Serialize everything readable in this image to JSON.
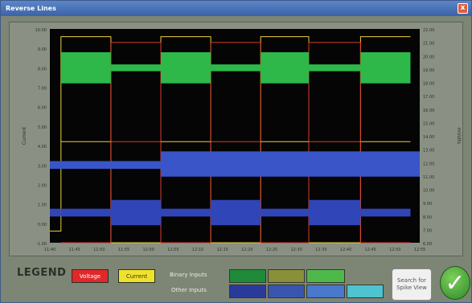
{
  "window": {
    "title": "Reverse Lines",
    "close_glyph": "x"
  },
  "chart": {
    "y_left_label": "Current",
    "y_right_label": "mVolts",
    "y_left_ticks": [
      "10.00",
      "9.00",
      "8.00",
      "7.00",
      "6.00",
      "5.00",
      "4.00",
      "3.00",
      "2.00",
      "1.00",
      "0.00",
      "-1.00"
    ],
    "y_right_ticks": [
      "22.00",
      "21.00",
      "20.00",
      "19.00",
      "18.00",
      "17.00",
      "16.00",
      "15.00",
      "14.00",
      "13.00",
      "12.00",
      "11.00",
      "10.00",
      "9.00",
      "8.00",
      "7.00",
      "6.00"
    ],
    "x_ticks": [
      "11:40",
      "11:45",
      "11:50",
      "11:55",
      "12:00",
      "12:05",
      "12:10",
      "12:15",
      "12:20",
      "12:25",
      "12:30",
      "12:35",
      "12:40",
      "12:45",
      "12:50",
      "12:55"
    ]
  },
  "legend": {
    "title": "LEGEND",
    "voltage_label": "Voltage",
    "current_label": "Current",
    "binary_label": "Binary Inputs",
    "other_label": "Other Inputs",
    "binary_colors": [
      "#1f8a3a",
      "#8a8f3a",
      "#4fb84a"
    ],
    "other_colors": [
      "#2a3a9a",
      "#3a55b0",
      "#4a78cc",
      "#4fc3cf"
    ],
    "search_label": "Search for Spike View",
    "ok_icon": "checkmark-icon"
  },
  "chart_data": {
    "type": "line",
    "y_left_range": [
      -1,
      10
    ],
    "series": [
      {
        "color": "#d93a2a",
        "kind": "square-wave"
      },
      {
        "color": "#e8d03a",
        "kind": "square-wave"
      },
      {
        "color": "#2eb84a",
        "kind": "band"
      },
      {
        "color": "#3a55c8",
        "kind": "band"
      }
    ]
  }
}
